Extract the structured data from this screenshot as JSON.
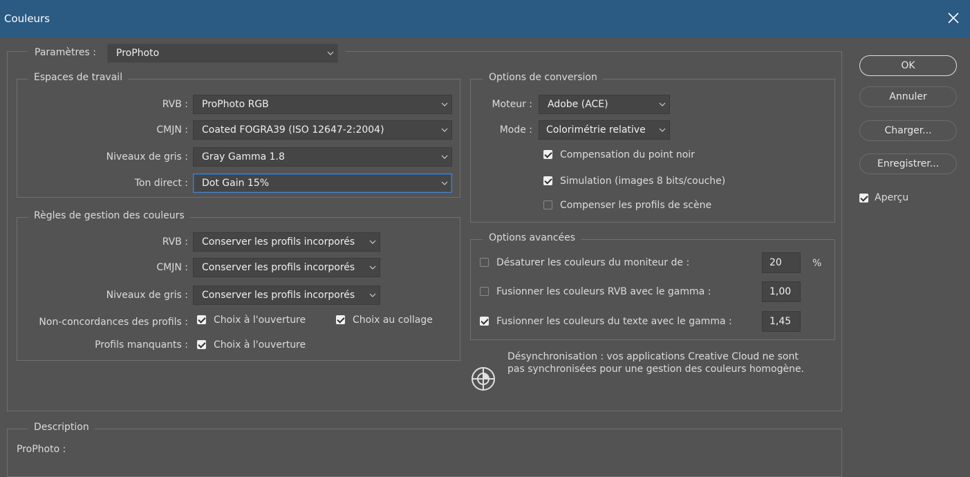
{
  "window": {
    "title": "Couleurs"
  },
  "settings": {
    "label": "Paramètres :",
    "value": "ProPhoto"
  },
  "working_spaces": {
    "legend": "Espaces de travail",
    "rgb": {
      "label": "RVB :",
      "value": "ProPhoto RGB"
    },
    "cmyk": {
      "label": "CMJN :",
      "value": "Coated FOGRA39 (ISO 12647-2:2004)"
    },
    "gray": {
      "label": "Niveaux de gris :",
      "value": "Gray Gamma 1.8"
    },
    "spot": {
      "label": "Ton direct :",
      "value": "Dot Gain 15%"
    }
  },
  "policies": {
    "legend": "Règles de gestion des couleurs",
    "rgb": {
      "label": "RVB :",
      "value": "Conserver les profils incorporés"
    },
    "cmyk": {
      "label": "CMJN :",
      "value": "Conserver les profils incorporés"
    },
    "gray": {
      "label": "Niveaux de gris :",
      "value": "Conserver les profils incorporés"
    },
    "mismatch": {
      "label": "Non-concordances des profils :",
      "open": "Choix à l'ouverture",
      "paste": "Choix au collage"
    },
    "missing": {
      "label": "Profils manquants :",
      "open": "Choix à l'ouverture"
    }
  },
  "conversion": {
    "legend": "Options de conversion",
    "engine": {
      "label": "Moteur :",
      "value": "Adobe (ACE)"
    },
    "intent": {
      "label": "Mode :",
      "value": "Colorimétrie relative"
    },
    "bpc": "Compensation du point noir",
    "dither": "Simulation (images 8 bits/couche)",
    "scene": "Compenser les profils de scène"
  },
  "advanced": {
    "legend": "Options avancées",
    "desaturate": {
      "label": "Désaturer les couleurs du moniteur de :",
      "value": "20",
      "unit": "%"
    },
    "blend_rgb": {
      "label": "Fusionner les couleurs RVB avec le gamma :",
      "value": "1,00"
    },
    "blend_text": {
      "label": "Fusionner les couleurs du texte avec le gamma :",
      "value": "1,45"
    }
  },
  "sync": {
    "line1": "Désynchronisation : vos applications Creative Cloud ne sont",
    "line2": "pas synchronisées pour une gestion des couleurs homogène."
  },
  "description": {
    "legend": "Description",
    "text": "ProPhoto :"
  },
  "buttons": {
    "ok": "OK",
    "cancel": "Annuler",
    "load": "Charger...",
    "save": "Enregistrer...",
    "preview": "Aperçu"
  }
}
